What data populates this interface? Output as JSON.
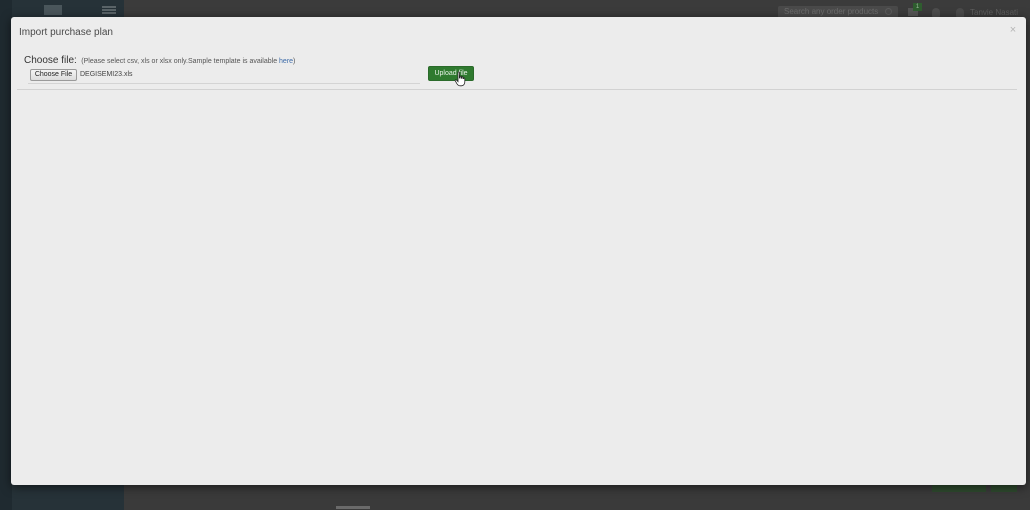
{
  "background_app": {
    "search_placeholder": "Search any order products",
    "cart_badge": "1",
    "user_name": "Tanvie Nasati"
  },
  "modal": {
    "title": "Import purchase plan",
    "close_label": "×",
    "choose_file_label": "Choose file:",
    "choose_file_hint": "(Please select csv, xls or xlsx only.Sample template is available ",
    "here_link": "here",
    "choose_file_hint_end": ")",
    "file_button_label": "Choose File",
    "file_name": "DEGISEMI23.xls",
    "upload_button_label": "Upload file"
  },
  "colors": {
    "upload_button": "#2f7a2f",
    "modal_background": "#ececec",
    "link": "#3b6aa8"
  },
  "icons": {
    "cursor": "hand-pointer-icon",
    "close": "close-icon"
  }
}
